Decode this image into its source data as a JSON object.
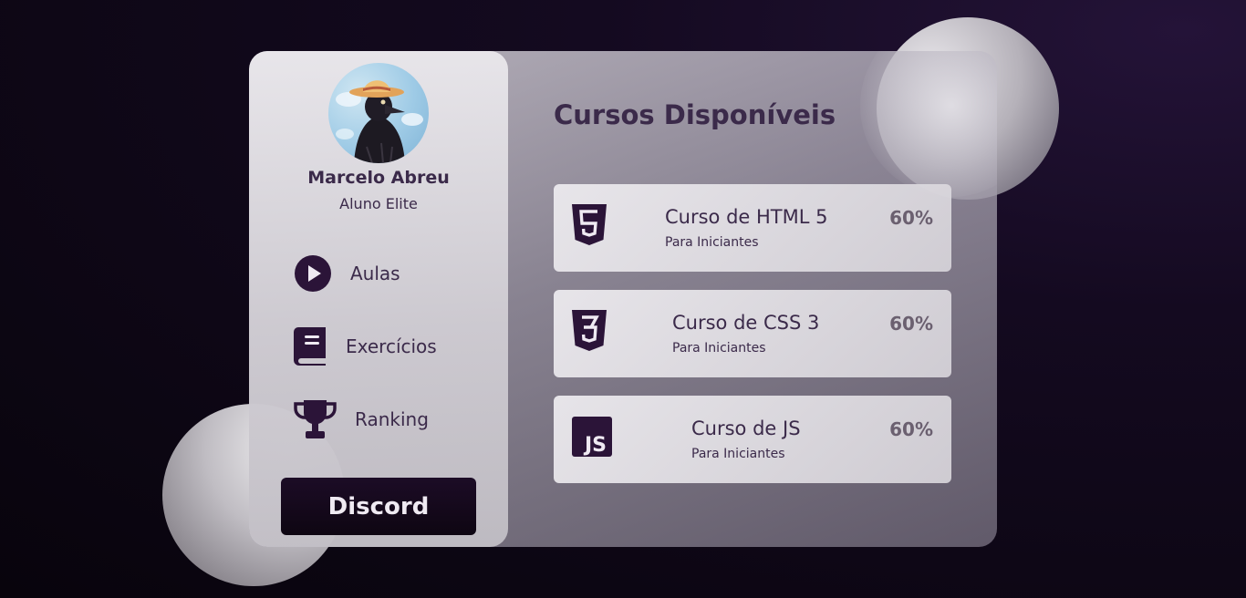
{
  "colors": {
    "accent": "#2b1438",
    "text": "#3b2a4a",
    "percent": "#6b6070",
    "button_bg": "#140a1a"
  },
  "profile": {
    "name": "Marcelo Abreu",
    "role": "Aluno Elite",
    "avatar_icon": "crow-with-hat-avatar"
  },
  "nav": {
    "items": [
      {
        "label": "Aulas",
        "icon": "play-circle-icon"
      },
      {
        "label": "Exercícios",
        "icon": "book-icon"
      },
      {
        "label": "Ranking",
        "icon": "trophy-icon"
      }
    ]
  },
  "discord_button": {
    "label": "Discord"
  },
  "main": {
    "title": "Cursos Disponíveis",
    "courses": [
      {
        "title": "Curso de HTML 5",
        "subtitle": "Para Iniciantes",
        "progress": "60%",
        "icon": "html5-icon"
      },
      {
        "title": "Curso de CSS 3",
        "subtitle": "Para Iniciantes",
        "progress": "60%",
        "icon": "css3-icon"
      },
      {
        "title": "Curso de JS",
        "subtitle": "Para Iniciantes",
        "progress": "60%",
        "icon": "js-icon"
      }
    ]
  }
}
